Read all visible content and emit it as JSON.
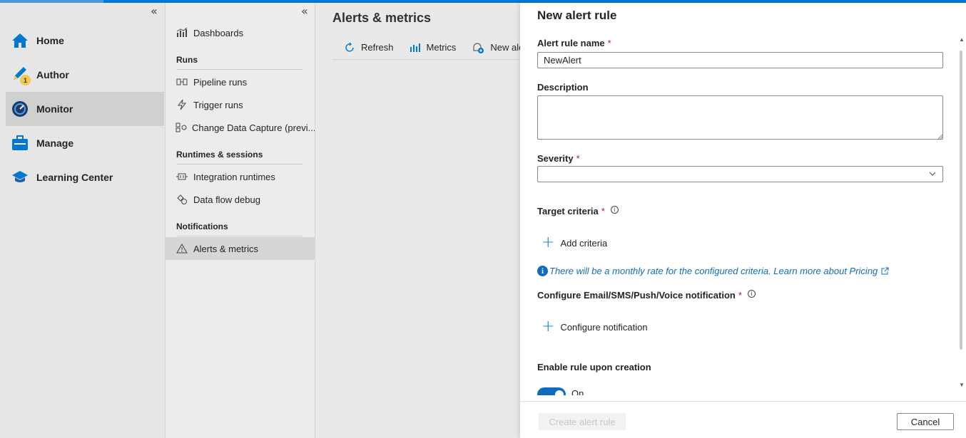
{
  "leftnav": {
    "collapse_glyph": "«",
    "items": [
      {
        "label": "Home",
        "icon": "home-icon"
      },
      {
        "label": "Author",
        "icon": "pencil-icon",
        "badge": "1"
      },
      {
        "label": "Monitor",
        "icon": "monitor-gauge-icon",
        "active": true
      },
      {
        "label": "Manage",
        "icon": "toolbox-icon"
      },
      {
        "label": "Learning Center",
        "icon": "graduation-cap-icon"
      }
    ]
  },
  "subnav": {
    "collapse_glyph": "«",
    "dashboards": "Dashboards",
    "sections": {
      "runs": "Runs",
      "runtimes": "Runtimes & sessions",
      "notifications": "Notifications"
    },
    "items": {
      "pipeline_runs": "Pipeline runs",
      "trigger_runs": "Trigger runs",
      "change_data_capture": "Change Data Capture (previ...",
      "integration_runtimes": "Integration runtimes",
      "data_flow_debug": "Data flow debug",
      "alerts_metrics": "Alerts & metrics"
    }
  },
  "main": {
    "title": "Alerts & metrics",
    "toolbar": {
      "refresh": "Refresh",
      "metrics": "Metrics",
      "new_alert": "New ale"
    }
  },
  "panel": {
    "title": "New alert rule",
    "alert_rule_name_label": "Alert rule name",
    "alert_rule_name_value": "NewAlert",
    "required_marker": "*",
    "description_label": "Description",
    "description_value": "",
    "severity_label": "Severity",
    "severity_value": "",
    "target_criteria_label": "Target criteria",
    "add_criteria": "Add criteria",
    "pricing_info": "There will be a monthly rate for the configured criteria. Learn more about Pricing",
    "configure_notification_label": "Configure Email/SMS/Push/Voice notification",
    "configure_notification": "Configure notification",
    "enable_rule_label": "Enable rule upon creation",
    "toggle_state": "On",
    "create_button": "Create alert rule",
    "cancel_button": "Cancel"
  },
  "colors": {
    "accent": "#0078d4",
    "link": "#0f6cbd",
    "required": "#a4262c",
    "active_nav": "#d0d0d0"
  }
}
